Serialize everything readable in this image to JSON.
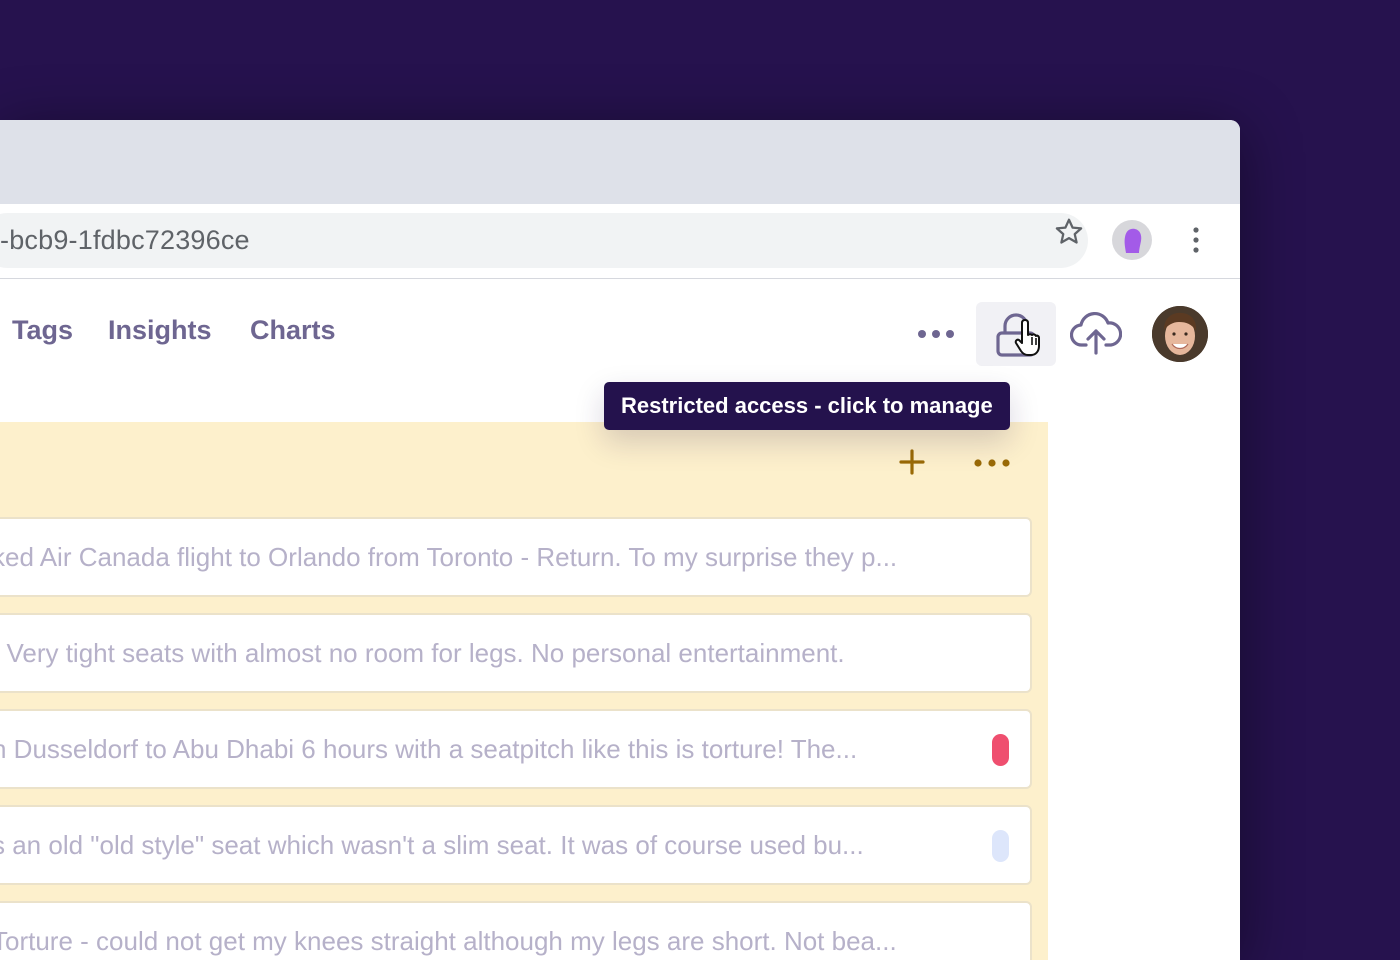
{
  "browser": {
    "url": "-bcb9-1fdbc72396ce"
  },
  "nav": {
    "items": [
      {
        "label": "Tags"
      },
      {
        "label": "Insights"
      },
      {
        "label": "Charts"
      }
    ]
  },
  "tooltip": {
    "text": "Restricted access - click to manage"
  },
  "board": {
    "cards": [
      {
        "text": "ked Air Canada flight to Orlando from Toronto - Return. To my surprise they p...",
        "tag_color": ""
      },
      {
        "text": "t Very tight seats with almost no room for legs. No personal entertainment.",
        "tag_color": ""
      },
      {
        "text": "n Dusseldorf to Abu Dhabi 6 hours with a seatpitch like this is torture! The...",
        "tag_color": "#ef4f6f"
      },
      {
        "text": "s an old \"old style\" seat which wasn't a slim seat. It was of course used bu...",
        "tag_color": "#dde6fb"
      },
      {
        "text": "Torture - could not get my knees straight although my legs are short. Not bea...",
        "tag_color": ""
      }
    ]
  },
  "colors": {
    "background": "#26124e",
    "nav_text": "#6e6691",
    "board_bg": "#fdf0cc",
    "board_accent": "#9a6a06",
    "tooltip_bg": "#24124d"
  },
  "icons": {
    "star": "star-icon",
    "profile": "profile-icon",
    "menu": "kebab-menu-icon",
    "more": "more-horizontal-icon",
    "lock": "lock-icon",
    "cursor": "hand-pointer-icon",
    "upload": "cloud-upload-icon",
    "add": "plus-icon"
  }
}
